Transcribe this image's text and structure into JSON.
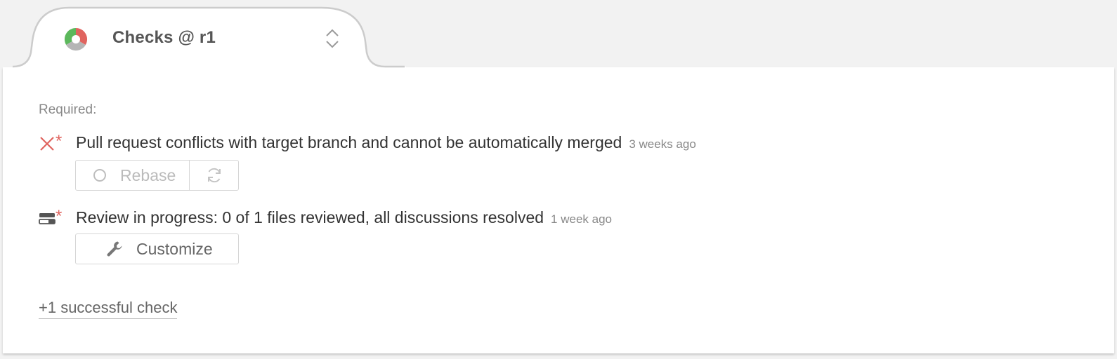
{
  "header": {
    "title": "Checks @ r1",
    "status_icon": "status-pie-icon",
    "chevron_icon": "expand-collapse-chevron-icon"
  },
  "required_label": "Required:",
  "checks": [
    {
      "status_icon": "failed-x-icon",
      "required_marker": "*",
      "text": "Pull request conflicts with target branch and cannot be automatically merged",
      "time": "3 weeks ago"
    },
    {
      "status_icon": "review-in-progress-icon",
      "required_marker": "*",
      "text": "Review in progress: 0 of 1 files reviewed, all discussions resolved",
      "time": "1 week ago"
    }
  ],
  "actions": {
    "rebase_label": "Rebase",
    "refresh_icon": "refresh-icon",
    "customize_label": "Customize",
    "customize_icon": "wrench-icon"
  },
  "success_link": "+1 successful check",
  "colors": {
    "success": "#5cb85c",
    "failure": "#e0645f",
    "neutral": "#bbbbbb",
    "panel_bg": "#ffffff",
    "page_bg": "#f2f2f2"
  }
}
